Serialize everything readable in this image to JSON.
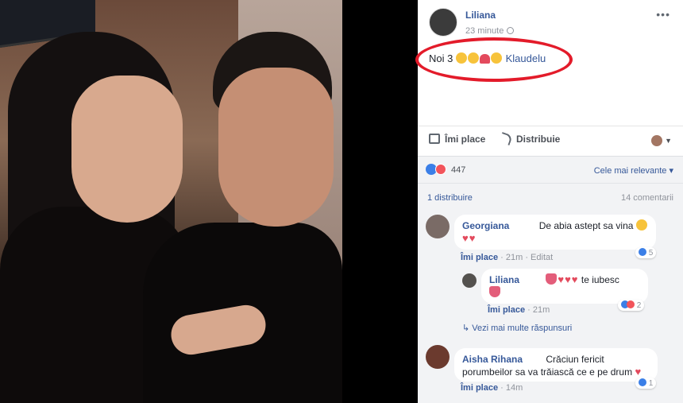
{
  "post": {
    "author": "Liliana",
    "time": "23 minute",
    "text_main": "Noi 3",
    "tagged": "Klaudelu",
    "emoji_names": [
      "baby-angel",
      "heart-eyes",
      "heart",
      "muscle"
    ]
  },
  "actions": {
    "like_label": "Îmi place",
    "share_label": "Distribuie"
  },
  "reactions": {
    "count": "447",
    "sort_label": "Cele mai relevante"
  },
  "stats": {
    "shares": "1 distribuire",
    "comments": "14 comentarii"
  },
  "comments": [
    {
      "name": "Georgiana",
      "text": "De abia astept sa vina",
      "like": "Îmi place",
      "time": "21m",
      "edited": "Editat",
      "reactions": "5"
    },
    {
      "name": "Liliana",
      "text": "te iubesc",
      "like": "Îmi place",
      "time": "21m",
      "reactions": "2"
    },
    {
      "name": "Aisha Rihana",
      "text1": "Crăciun fericit",
      "text2": "porumbeilor sa va trăiască ce e pe drum",
      "like": "Îmi place",
      "time": "14m",
      "reactions": "1"
    }
  ],
  "more_replies": "Vezi mai multe răspunsuri",
  "colors": {
    "link": "#365899",
    "annotation": "#e31b2a",
    "like_blue": "#3b7fe7",
    "love_red": "#f2545b"
  }
}
